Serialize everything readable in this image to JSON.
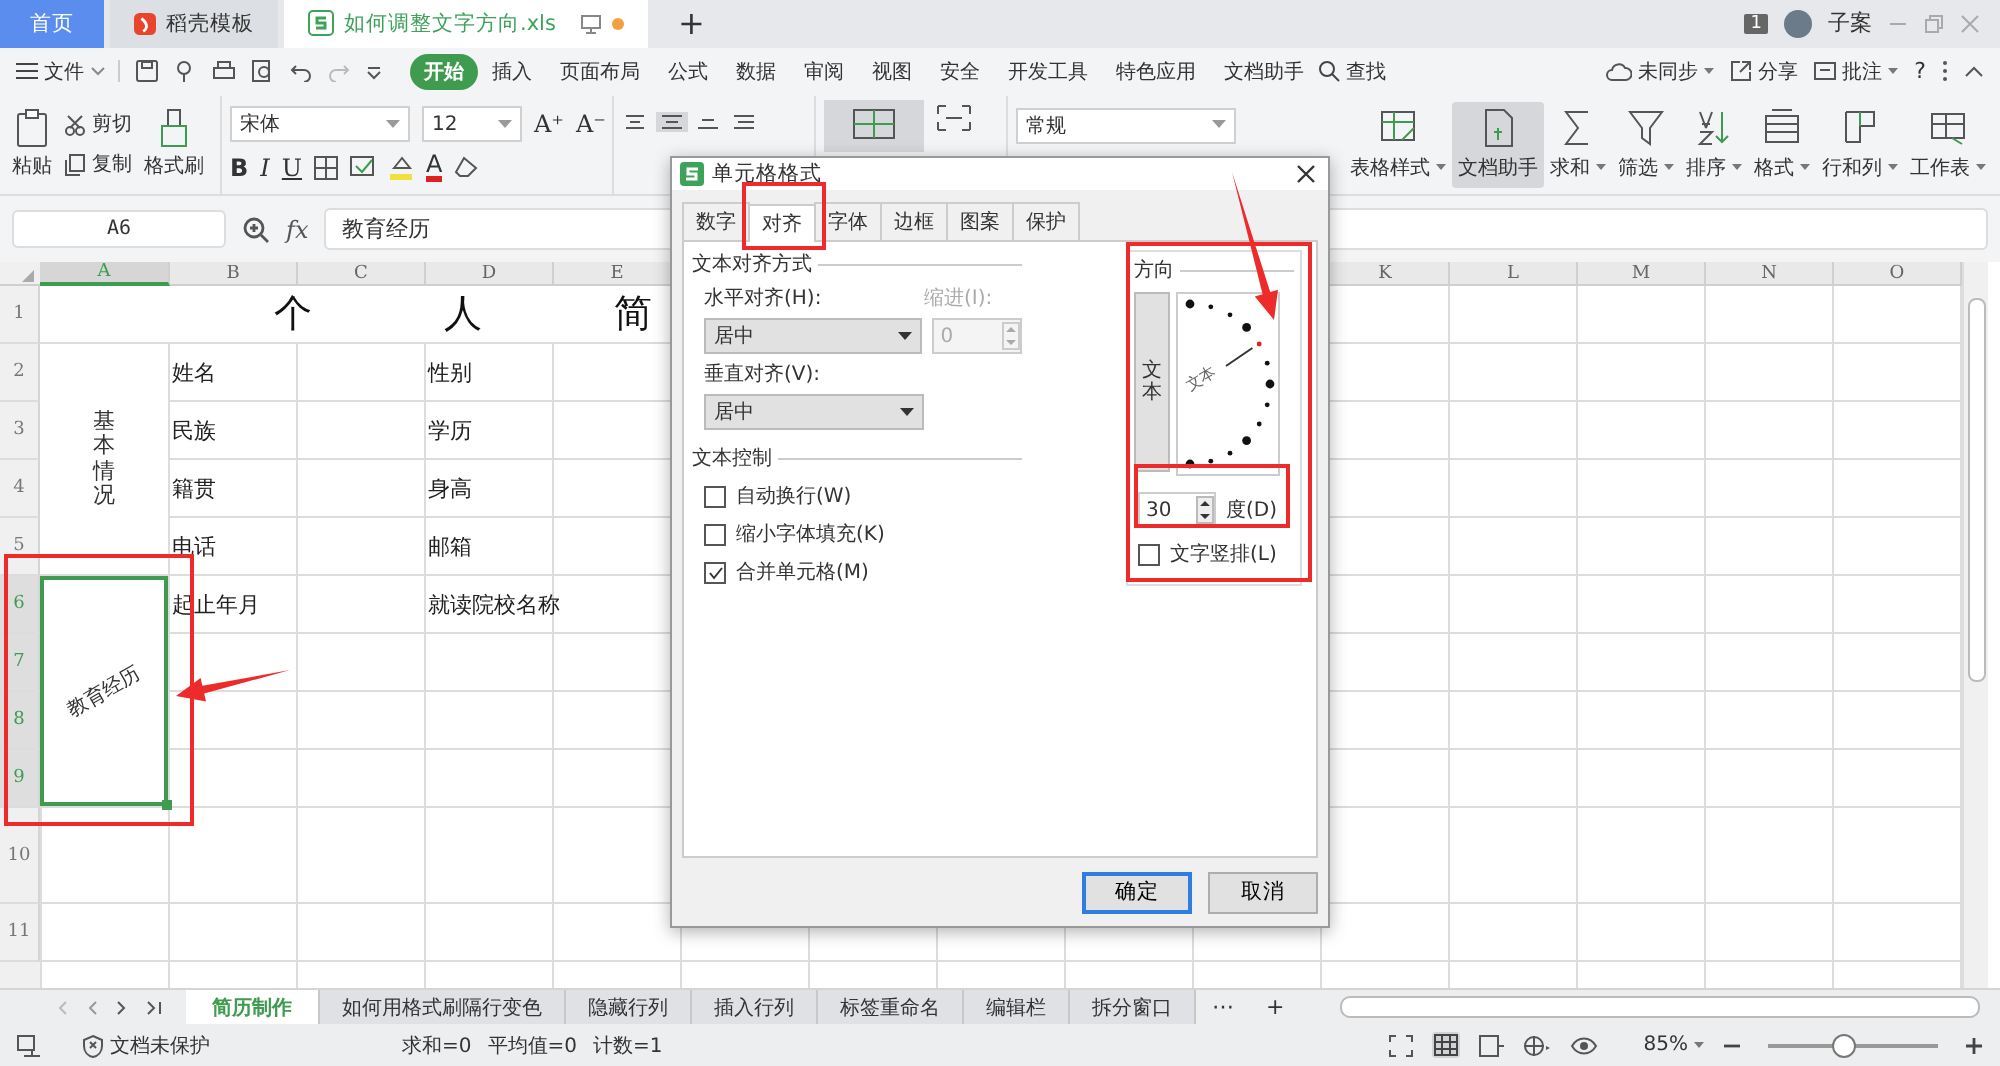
{
  "title_tabs": [
    {
      "label": "首页",
      "kind": "home",
      "selected": false
    },
    {
      "label": "稻壳模板",
      "kind": "template",
      "selected": false
    },
    {
      "label": "如何调整文字方向.xls",
      "kind": "document",
      "selected": true
    }
  ],
  "new_tab": "+",
  "account": {
    "badge": "1",
    "user": "子案"
  },
  "menu": {
    "file": "文件",
    "items": [
      {
        "label": "开始",
        "selected": true
      },
      {
        "label": "插入",
        "selected": false
      },
      {
        "label": "页面布局",
        "selected": false
      },
      {
        "label": "公式",
        "selected": false
      },
      {
        "label": "数据",
        "selected": false
      },
      {
        "label": "审阅",
        "selected": false
      },
      {
        "label": "视图",
        "selected": false
      },
      {
        "label": "安全",
        "selected": false
      },
      {
        "label": "开发工具",
        "selected": false
      },
      {
        "label": "特色应用",
        "selected": false
      },
      {
        "label": "文档助手",
        "selected": false
      }
    ],
    "search": "查找",
    "sync": "未同步",
    "share": "分享",
    "comment": "批注",
    "help": "?"
  },
  "ribbon": {
    "paste": "粘贴",
    "cut": "剪切",
    "copy": "复制",
    "format_painter": "格式刷",
    "font_name": "宋体",
    "font_size": "12",
    "grow_font": "A⁺",
    "shrink_font": "A⁻",
    "style_buttons": [
      "B",
      "I",
      "U"
    ],
    "font_color": "A",
    "number_format": "常规",
    "tools": [
      {
        "label": "表格样式",
        "selected": false
      },
      {
        "label": "文档助手",
        "selected": true
      },
      {
        "label": "求和",
        "selected": false
      },
      {
        "label": "筛选",
        "selected": false
      },
      {
        "label": "排序",
        "selected": false
      },
      {
        "label": "格式",
        "selected": false
      },
      {
        "label": "行和列",
        "selected": false
      },
      {
        "label": "工作表",
        "selected": false
      }
    ]
  },
  "formula_bar": {
    "name_box": "A6",
    "fx": "fx",
    "value": "教育经历"
  },
  "sheet": {
    "columns_left": [
      {
        "label": "A",
        "selected": true
      },
      {
        "label": "B",
        "selected": false
      },
      {
        "label": "C",
        "selected": false
      },
      {
        "label": "D",
        "selected": false
      },
      {
        "label": "E",
        "selected": false
      }
    ],
    "columns_right": [
      {
        "label": "K",
        "selected": false
      },
      {
        "label": "L",
        "selected": false
      },
      {
        "label": "M",
        "selected": false
      },
      {
        "label": "N",
        "selected": false
      },
      {
        "label": "O",
        "selected": false
      }
    ],
    "title_chars": [
      "个",
      "人",
      "简"
    ],
    "rows": [
      {
        "number": "1",
        "selected": false
      },
      {
        "number": "2",
        "selected": false,
        "b": "姓名",
        "d": "性别"
      },
      {
        "number": "3",
        "selected": false,
        "b": "民族",
        "d": "学历"
      },
      {
        "number": "4",
        "selected": false,
        "b": "籍贯",
        "d": "身高"
      },
      {
        "number": "5",
        "selected": false,
        "b": "电话",
        "d": "邮箱"
      },
      {
        "number": "6",
        "selected": true,
        "b": "起止年月",
        "d": "就读院校名称"
      },
      {
        "number": "7",
        "selected": true
      },
      {
        "number": "8",
        "selected": true
      },
      {
        "number": "9",
        "selected": true
      },
      {
        "number": "10",
        "selected": false
      },
      {
        "number": "11",
        "selected": false
      }
    ],
    "merged": [
      {
        "text": "基本情况",
        "kind": "vertical",
        "selected": false
      },
      {
        "text": "教育经历",
        "kind": "rotated",
        "selected": true
      }
    ]
  },
  "sheet_tabs": {
    "items": [
      {
        "label": "简历制作",
        "selected": true
      },
      {
        "label": "如何用格式刷隔行变色",
        "selected": false
      },
      {
        "label": "隐藏行列",
        "selected": false
      },
      {
        "label": "插入行列",
        "selected": false
      },
      {
        "label": "标签重命名",
        "selected": false
      },
      {
        "label": "编辑栏",
        "selected": false
      },
      {
        "label": "拆分窗口",
        "selected": false
      }
    ],
    "more": "⋯",
    "add": "+"
  },
  "status_bar": {
    "protection": "文档未保护",
    "stats": [
      "求和=0",
      "平均值=0",
      "计数=1"
    ],
    "zoom": "85%",
    "zoom_slider": {
      "level": 0.45
    }
  },
  "dialog": {
    "title": "单元格格式",
    "tabs": [
      {
        "label": "数字",
        "selected": false
      },
      {
        "label": "对齐",
        "selected": true
      },
      {
        "label": "字体",
        "selected": false
      },
      {
        "label": "边框",
        "selected": false
      },
      {
        "label": "图案",
        "selected": false
      },
      {
        "label": "保护",
        "selected": false
      }
    ],
    "alignment": {
      "heading": "文本对齐方式",
      "horizontal_label": "水平对齐(H):",
      "horizontal_value": "居中",
      "indent_label": "缩进(I):",
      "indent_value": "0",
      "indent_disabled": true,
      "vertical_label": "垂直对齐(V):",
      "vertical_value": "居中"
    },
    "control": {
      "heading": "文本控制",
      "options": [
        {
          "label": "自动换行(W)",
          "checked": false
        },
        {
          "label": "缩小字体填充(K)",
          "checked": false
        },
        {
          "label": "合并单元格(M)",
          "checked": true
        }
      ]
    },
    "orientation": {
      "heading": "方向",
      "vertical_text": "文本",
      "dial_text": "文本",
      "degrees": "30",
      "degrees_label": "度(D)",
      "stacked": {
        "label": "文字竖排(L)",
        "checked": false
      }
    },
    "buttons": [
      {
        "label": "确定",
        "default": true
      },
      {
        "label": "取消",
        "default": false
      }
    ]
  }
}
